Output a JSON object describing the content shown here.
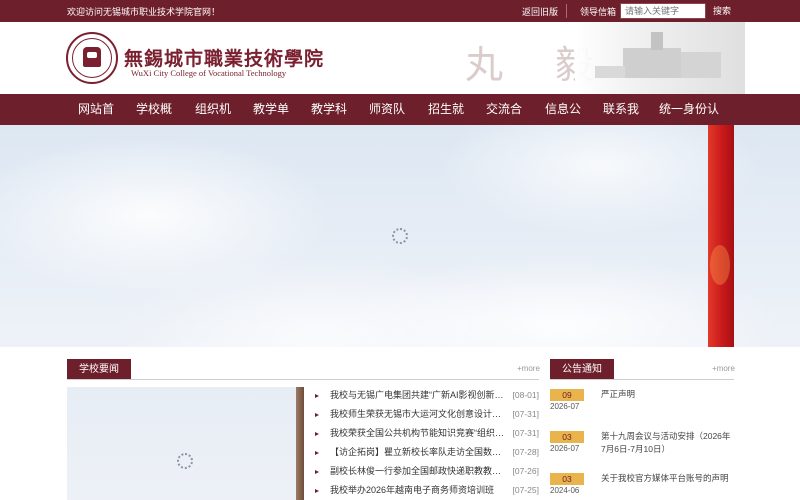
{
  "topbar": {
    "welcome": "欢迎访问无锡城市职业技术学院官网！",
    "old_version": "返回旧版",
    "leader_mail": "领导信箱",
    "search_placeholder": "请输入关键字",
    "search_button": "搜索"
  },
  "header": {
    "logo_cn": "無錫城市職業技術學院",
    "logo_en": "WuXi City College of Vocational Technology",
    "calligraphy": "丸 毅"
  },
  "nav": {
    "items": [
      "网站首页",
      "学校概况",
      "组织机构",
      "教学单位",
      "教学科研",
      "师资队伍",
      "招生就业",
      "交流合作",
      "信息公开",
      "联系我们",
      "统一身份认证"
    ]
  },
  "news": {
    "title": "学校要闻",
    "more": "+more",
    "items": [
      {
        "title": "我校与无锡广电集团共建“广新AI影视创新班”",
        "date": "[08-01]"
      },
      {
        "title": "我校师生荣获无锡市大运河文化创意设计大...",
        "date": "[07-31]"
      },
      {
        "title": "我校荣获全国公共机构节能知识竞赛“组织优...",
        "date": "[07-31]"
      },
      {
        "title": "【访企拓岗】瞿立新校长率队走访全国数智...",
        "date": "[07-28]"
      },
      {
        "title": "副校长林俊一行参加全国邮政快递职教教指...",
        "date": "[07-26]"
      },
      {
        "title": "我校举办2026年越南电子商务师资培训班",
        "date": "[07-25]"
      }
    ]
  },
  "notices": {
    "title": "公告通知",
    "more": "+more",
    "items": [
      {
        "day": "09",
        "ym": "2026-07",
        "text": "严正声明"
      },
      {
        "day": "03",
        "ym": "2026-07",
        "text": "第十九周会议与活动安排（2026年7月6日-7月10日）"
      },
      {
        "day": "03",
        "ym": "2024-06",
        "text": "关于我校官方媒体平台账号的声明"
      }
    ]
  },
  "colors": {
    "brand": "#6e1f2c",
    "accent": "#e9b44c"
  }
}
